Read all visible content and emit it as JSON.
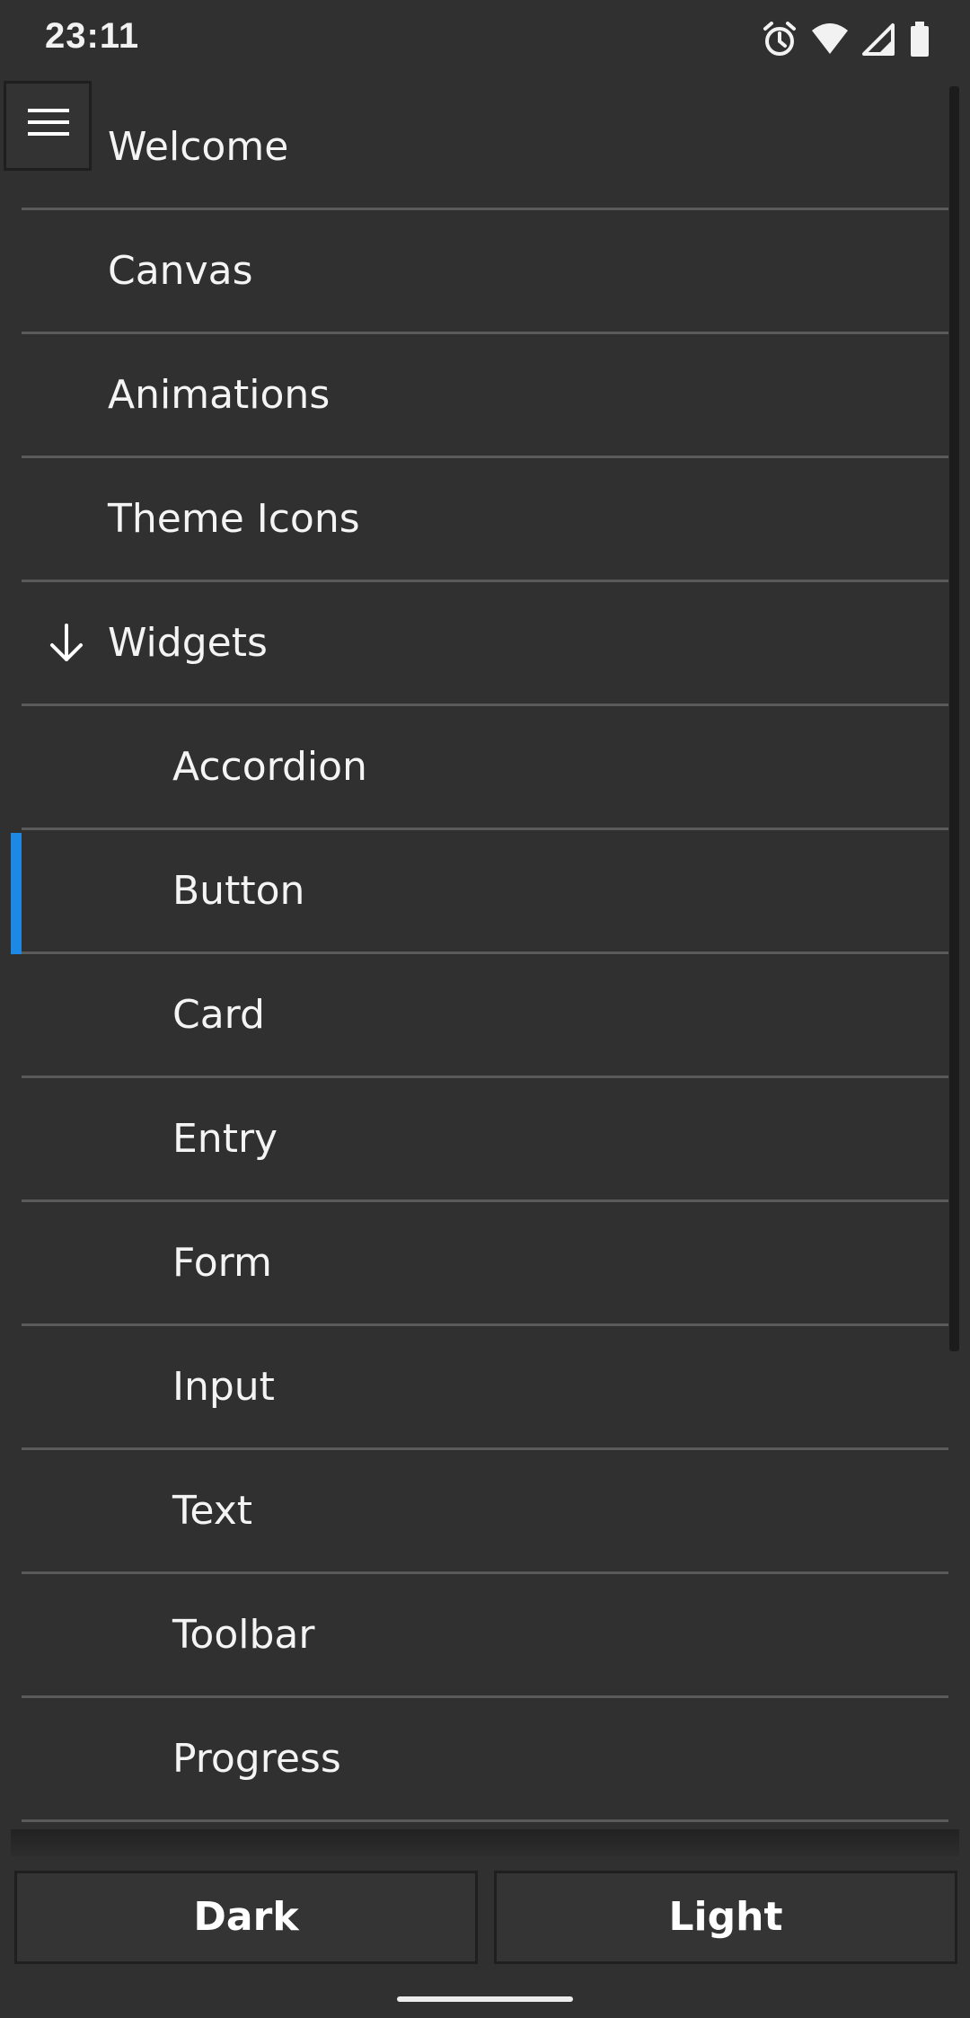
{
  "status_bar": {
    "time": "23:11",
    "icons": [
      "alarm-icon",
      "wifi-icon",
      "signal-icon",
      "battery-icon"
    ]
  },
  "nav": {
    "items": [
      {
        "label": "Welcome",
        "level": 0
      },
      {
        "label": "Canvas",
        "level": 0
      },
      {
        "label": "Animations",
        "level": 0
      },
      {
        "label": "Theme Icons",
        "level": 0
      },
      {
        "label": "Widgets",
        "level": 0,
        "expanded": true
      },
      {
        "label": "Accordion",
        "level": 1
      },
      {
        "label": "Button",
        "level": 1,
        "selected": true
      },
      {
        "label": "Card",
        "level": 1
      },
      {
        "label": "Entry",
        "level": 1
      },
      {
        "label": "Form",
        "level": 1
      },
      {
        "label": "Input",
        "level": 1
      },
      {
        "label": "Text",
        "level": 1
      },
      {
        "label": "Toolbar",
        "level": 1
      },
      {
        "label": "Progress",
        "level": 1
      }
    ],
    "selected_color": "#1e88e5"
  },
  "theme_bar": {
    "dark_label": "Dark",
    "light_label": "Light"
  },
  "colors": {
    "background": "#303030",
    "divider": "#5a5a5a",
    "text": "#f4f4f4"
  }
}
